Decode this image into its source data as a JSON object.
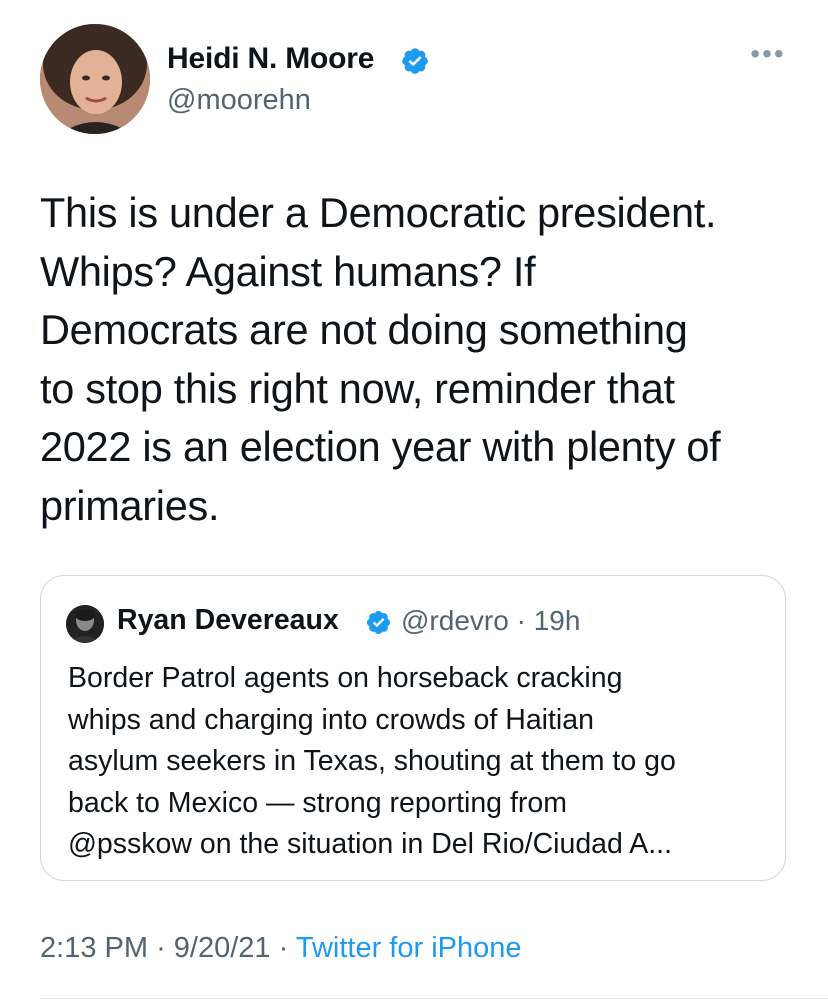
{
  "author": {
    "display_name": "Heidi N. Moore",
    "handle": "@moorehn",
    "verified": true
  },
  "more_icon": "ellipsis-icon",
  "tweet": {
    "lines": [
      "This is under a Democratic president.",
      "Whips? Against humans? If",
      "Democrats are not doing something",
      "to stop this right now, reminder that",
      "2022 is an election year with plenty of",
      "primaries."
    ]
  },
  "quoted": {
    "display_name": "Ryan Devereaux",
    "handle": "@rdevro",
    "separator": "·",
    "time": "19h",
    "verified": true,
    "lines": [
      "Border Patrol agents on horseback cracking",
      "whips and charging into crowds of Haitian",
      "asylum seekers in Texas, shouting at them to go",
      "back to Mexico — strong reporting from",
      "@psskow on the situation in Del Rio/Ciudad A..."
    ]
  },
  "footer": {
    "time": "2:13 PM",
    "sep1": "·",
    "date": "9/20/21",
    "sep2": "·",
    "source": "Twitter for iPhone"
  },
  "colors": {
    "link": "#1d9bf0",
    "muted": "#536471",
    "text": "#0f1419",
    "border": "#cfd9de"
  }
}
